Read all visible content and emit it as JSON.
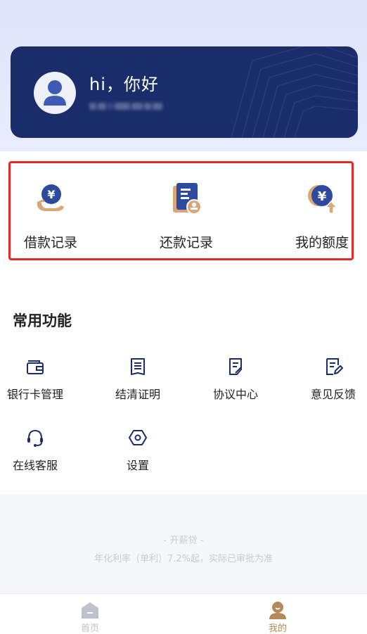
{
  "header": {
    "greeting": "hi，你好"
  },
  "records": [
    {
      "label": "借款记录",
      "icon": "loan-record-icon"
    },
    {
      "label": "还款记录",
      "icon": "repayment-record-icon"
    },
    {
      "label": "我的额度",
      "icon": "credit-limit-icon"
    }
  ],
  "features": {
    "title": "常用功能",
    "items": [
      {
        "label": "银行卡管理",
        "icon": "wallet-icon"
      },
      {
        "label": "结清证明",
        "icon": "document-icon"
      },
      {
        "label": "协议中心",
        "icon": "agreement-icon"
      },
      {
        "label": "意见反馈",
        "icon": "feedback-icon"
      },
      {
        "label": "在线客服",
        "icon": "headset-icon"
      },
      {
        "label": "设置",
        "icon": "settings-icon"
      }
    ]
  },
  "footer": {
    "brand": "- 开薪贷 -",
    "rate": "年化利率（单利）7.2%起，实际已审批为准"
  },
  "tabbar": {
    "items": [
      {
        "label": "首页",
        "icon": "home-icon",
        "active": false
      },
      {
        "label": "我的",
        "icon": "profile-icon",
        "active": true
      }
    ]
  },
  "colors": {
    "brand_navy": "#1b2c6b",
    "icon_blue": "#2d4a9e",
    "accent_gold": "#d9a678",
    "highlight_red": "#e32a2a",
    "tab_active": "#b28a5c",
    "tab_inactive": "#bfc2c8"
  }
}
